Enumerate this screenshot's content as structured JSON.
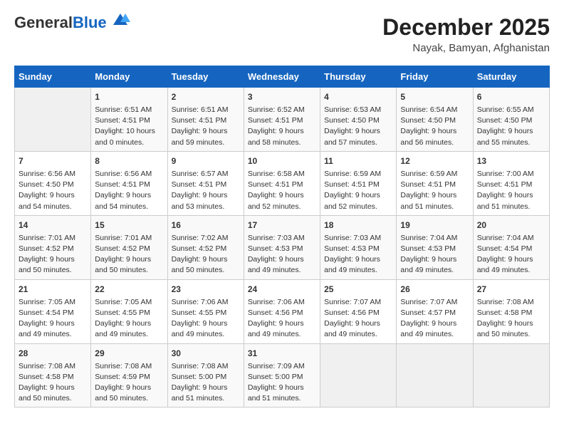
{
  "header": {
    "logo_line1": "General",
    "logo_line2": "Blue",
    "title": "December 2025",
    "subtitle": "Nayak, Bamyan, Afghanistan"
  },
  "days_of_week": [
    "Sunday",
    "Monday",
    "Tuesday",
    "Wednesday",
    "Thursday",
    "Friday",
    "Saturday"
  ],
  "weeks": [
    [
      {
        "day": "",
        "info": ""
      },
      {
        "day": "1",
        "info": "Sunrise: 6:51 AM\nSunset: 4:51 PM\nDaylight: 10 hours\nand 0 minutes."
      },
      {
        "day": "2",
        "info": "Sunrise: 6:51 AM\nSunset: 4:51 PM\nDaylight: 9 hours\nand 59 minutes."
      },
      {
        "day": "3",
        "info": "Sunrise: 6:52 AM\nSunset: 4:51 PM\nDaylight: 9 hours\nand 58 minutes."
      },
      {
        "day": "4",
        "info": "Sunrise: 6:53 AM\nSunset: 4:50 PM\nDaylight: 9 hours\nand 57 minutes."
      },
      {
        "day": "5",
        "info": "Sunrise: 6:54 AM\nSunset: 4:50 PM\nDaylight: 9 hours\nand 56 minutes."
      },
      {
        "day": "6",
        "info": "Sunrise: 6:55 AM\nSunset: 4:50 PM\nDaylight: 9 hours\nand 55 minutes."
      }
    ],
    [
      {
        "day": "7",
        "info": "Sunrise: 6:56 AM\nSunset: 4:50 PM\nDaylight: 9 hours\nand 54 minutes."
      },
      {
        "day": "8",
        "info": "Sunrise: 6:56 AM\nSunset: 4:51 PM\nDaylight: 9 hours\nand 54 minutes."
      },
      {
        "day": "9",
        "info": "Sunrise: 6:57 AM\nSunset: 4:51 PM\nDaylight: 9 hours\nand 53 minutes."
      },
      {
        "day": "10",
        "info": "Sunrise: 6:58 AM\nSunset: 4:51 PM\nDaylight: 9 hours\nand 52 minutes."
      },
      {
        "day": "11",
        "info": "Sunrise: 6:59 AM\nSunset: 4:51 PM\nDaylight: 9 hours\nand 52 minutes."
      },
      {
        "day": "12",
        "info": "Sunrise: 6:59 AM\nSunset: 4:51 PM\nDaylight: 9 hours\nand 51 minutes."
      },
      {
        "day": "13",
        "info": "Sunrise: 7:00 AM\nSunset: 4:51 PM\nDaylight: 9 hours\nand 51 minutes."
      }
    ],
    [
      {
        "day": "14",
        "info": "Sunrise: 7:01 AM\nSunset: 4:52 PM\nDaylight: 9 hours\nand 50 minutes."
      },
      {
        "day": "15",
        "info": "Sunrise: 7:01 AM\nSunset: 4:52 PM\nDaylight: 9 hours\nand 50 minutes."
      },
      {
        "day": "16",
        "info": "Sunrise: 7:02 AM\nSunset: 4:52 PM\nDaylight: 9 hours\nand 50 minutes."
      },
      {
        "day": "17",
        "info": "Sunrise: 7:03 AM\nSunset: 4:53 PM\nDaylight: 9 hours\nand 49 minutes."
      },
      {
        "day": "18",
        "info": "Sunrise: 7:03 AM\nSunset: 4:53 PM\nDaylight: 9 hours\nand 49 minutes."
      },
      {
        "day": "19",
        "info": "Sunrise: 7:04 AM\nSunset: 4:53 PM\nDaylight: 9 hours\nand 49 minutes."
      },
      {
        "day": "20",
        "info": "Sunrise: 7:04 AM\nSunset: 4:54 PM\nDaylight: 9 hours\nand 49 minutes."
      }
    ],
    [
      {
        "day": "21",
        "info": "Sunrise: 7:05 AM\nSunset: 4:54 PM\nDaylight: 9 hours\nand 49 minutes."
      },
      {
        "day": "22",
        "info": "Sunrise: 7:05 AM\nSunset: 4:55 PM\nDaylight: 9 hours\nand 49 minutes."
      },
      {
        "day": "23",
        "info": "Sunrise: 7:06 AM\nSunset: 4:55 PM\nDaylight: 9 hours\nand 49 minutes."
      },
      {
        "day": "24",
        "info": "Sunrise: 7:06 AM\nSunset: 4:56 PM\nDaylight: 9 hours\nand 49 minutes."
      },
      {
        "day": "25",
        "info": "Sunrise: 7:07 AM\nSunset: 4:56 PM\nDaylight: 9 hours\nand 49 minutes."
      },
      {
        "day": "26",
        "info": "Sunrise: 7:07 AM\nSunset: 4:57 PM\nDaylight: 9 hours\nand 49 minutes."
      },
      {
        "day": "27",
        "info": "Sunrise: 7:08 AM\nSunset: 4:58 PM\nDaylight: 9 hours\nand 50 minutes."
      }
    ],
    [
      {
        "day": "28",
        "info": "Sunrise: 7:08 AM\nSunset: 4:58 PM\nDaylight: 9 hours\nand 50 minutes."
      },
      {
        "day": "29",
        "info": "Sunrise: 7:08 AM\nSunset: 4:59 PM\nDaylight: 9 hours\nand 50 minutes."
      },
      {
        "day": "30",
        "info": "Sunrise: 7:08 AM\nSunset: 5:00 PM\nDaylight: 9 hours\nand 51 minutes."
      },
      {
        "day": "31",
        "info": "Sunrise: 7:09 AM\nSunset: 5:00 PM\nDaylight: 9 hours\nand 51 minutes."
      },
      {
        "day": "",
        "info": ""
      },
      {
        "day": "",
        "info": ""
      },
      {
        "day": "",
        "info": ""
      }
    ]
  ]
}
